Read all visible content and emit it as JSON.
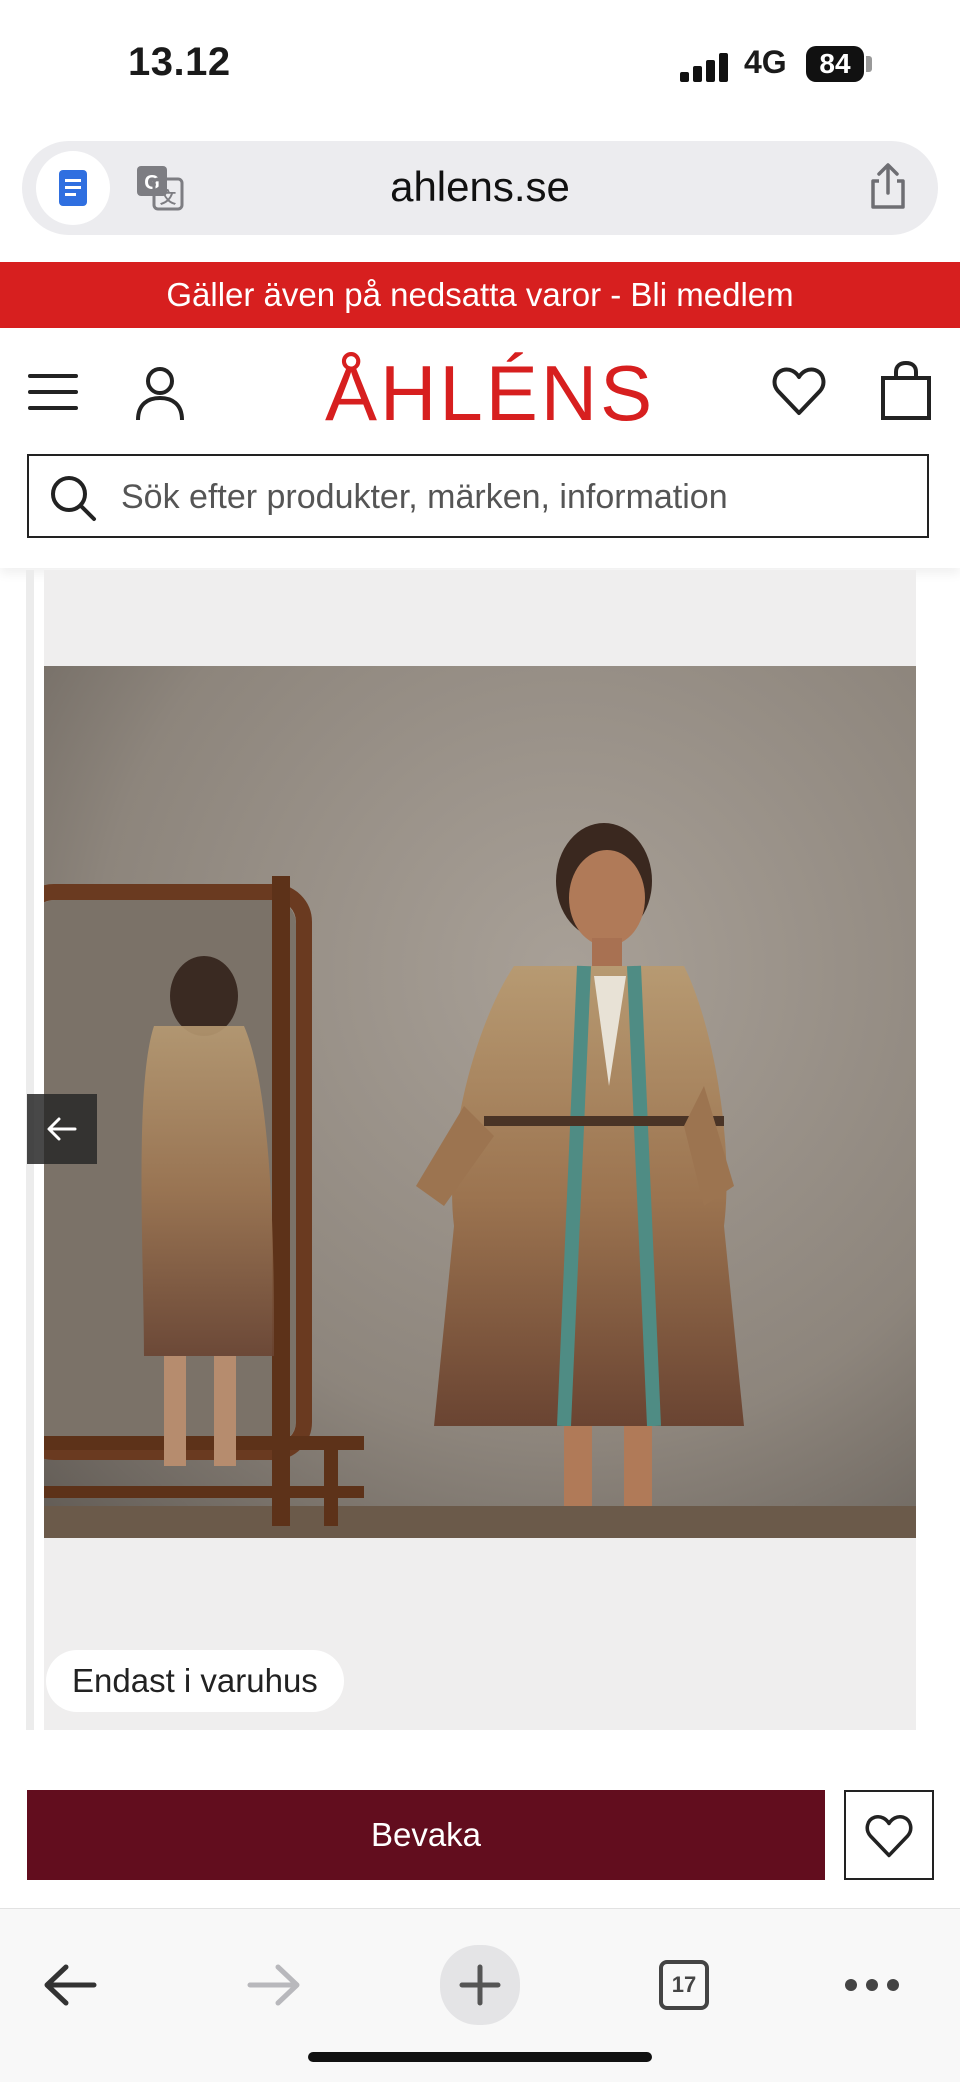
{
  "status_bar": {
    "time": "13.12",
    "network": "4G",
    "battery": "84"
  },
  "browser": {
    "url": "ahlens.se",
    "icons": {
      "reader": "reader-mode-icon",
      "translate": "translate-icon",
      "share": "share-icon"
    }
  },
  "promo": {
    "text": "Gäller även på nedsatta varor - Bli medlem"
  },
  "header": {
    "logo": "ÅHLÉNS",
    "icons": {
      "menu": "hamburger-menu-icon",
      "account": "user-icon",
      "wishlist": "heart-icon",
      "bag": "shopping-bag-icon"
    }
  },
  "search": {
    "placeholder": "Sök efter produkter, märken, information"
  },
  "product": {
    "badge": "Endast i varuhus",
    "watch_label": "Bevaka"
  },
  "toolbar": {
    "tab_count": "17"
  },
  "colors": {
    "brand_red": "#d71f1f",
    "watch_button": "#620d1e"
  }
}
